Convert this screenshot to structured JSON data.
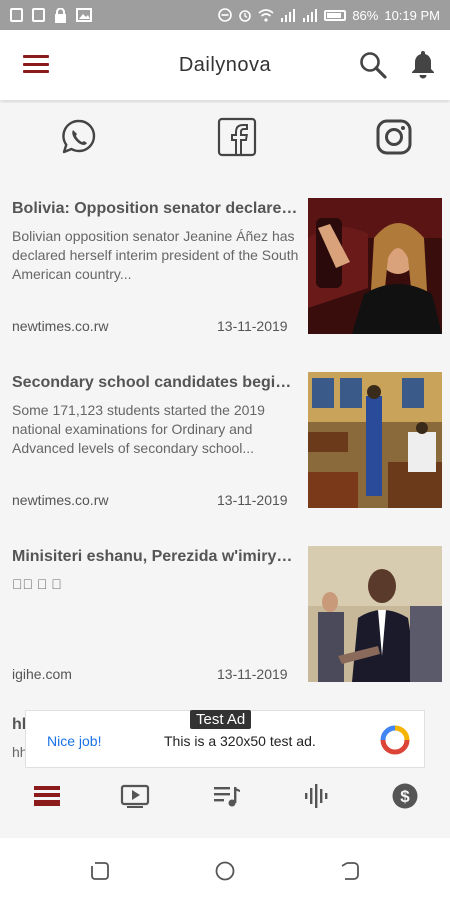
{
  "status_bar": {
    "battery": "86%",
    "time": "10:19 PM"
  },
  "header": {
    "title": "Dailynova"
  },
  "social": [
    "whatsapp-icon",
    "facebook-icon",
    "instagram-icon"
  ],
  "news": [
    {
      "title": "Bolivia: Opposition senator declares herself interim president",
      "summary": "Bolivian opposition senator Jeanine Áñez has declared herself interim president of the South American country...",
      "source": "newtimes.co.rw",
      "date": "13-11-2019"
    },
    {
      "title": "Secondary school candidates begin national exams",
      "summary": "Some 171,123 students started the 2019 national examinations for Ordinary and Advanced levels of secondary school...",
      "source": "newtimes.co.rw",
      "date": "13-11-2019"
    },
    {
      "title": "Minisiteri eshanu, Perezida w'imiryango",
      "summary": "\u0000\u0000 \u0000 \u0000",
      "source": "igihe.com",
      "date": "13-11-2019"
    },
    {
      "title": "hl",
      "summary": "hh"
    }
  ],
  "ad": {
    "tag": "Test Ad",
    "nice": "Nice job!",
    "text": "This is a 320x50 test ad."
  },
  "colors": {
    "accent": "#8b1a1a",
    "link": "#1a73e8"
  }
}
